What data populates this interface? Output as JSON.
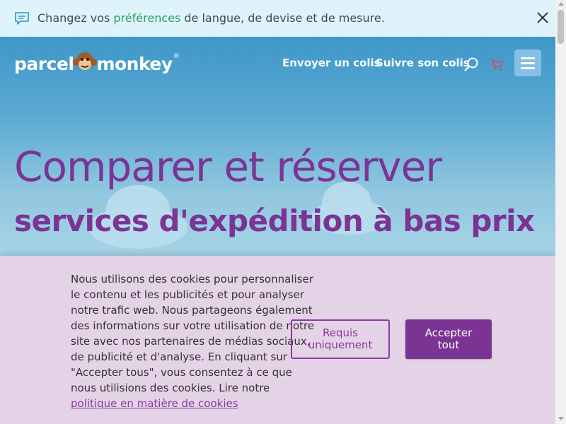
{
  "notice": {
    "icon": "chat-message-icon",
    "text_before": "Changez vos ",
    "link": "préférences",
    "text_after": " de langue, de devise et de mesure.",
    "close_icon": "close-icon"
  },
  "header": {
    "logo": {
      "word_left": "parcel",
      "word_right": "monkey",
      "reg": "®"
    },
    "nav": {
      "send": "Envoyer un colis",
      "track": "Suivre son colis"
    },
    "icons": {
      "search": "search-icon",
      "cart": "cart-icon",
      "menu": "hamburger-menu-icon"
    }
  },
  "hero": {
    "headline": "Comparer et réserver",
    "subline": "services d'expédition à bas prix"
  },
  "cookie": {
    "text": "Nous utilisons des cookies pour personnaliser le contenu et les publicités et pour analyser notre trafic web. Nous partageons également des informations sur votre utilisation de notre site avec nos partenaires de médias sociaux, de publicité et d'analyse. En cliquant sur \"Accepter tous\", vous consentez à ce que nous utilisions des cookies. Lire notre ",
    "link": "politique en matière de cookies",
    "required_line1": "Requis",
    "required_line2": "uniquement",
    "accept_line1": "Accepter",
    "accept_line2": "tout"
  },
  "colors": {
    "brand_purple": "#7b3494",
    "link_green": "#2aa05a",
    "sky_blue": "#3e97c9",
    "cookie_bg": "#e4d3e6"
  }
}
